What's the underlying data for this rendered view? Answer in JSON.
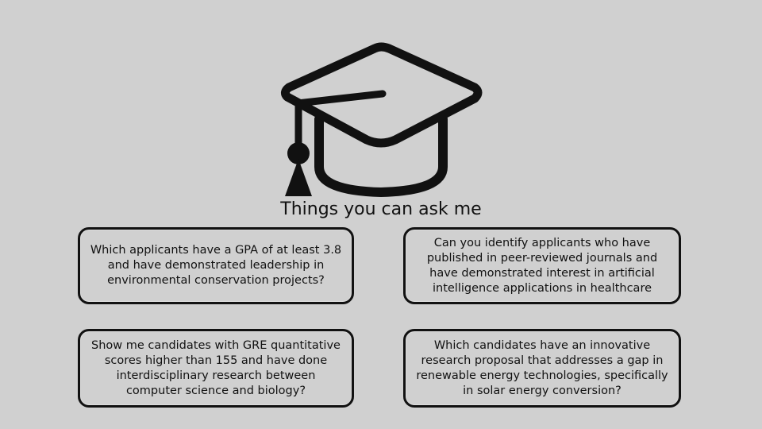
{
  "logo_icon": "graduation-cap-icon",
  "heading": "Things you can ask me",
  "suggestions": [
    {
      "text": "Which applicants have a GPA of at least 3.8 and have demonstrated leadership in environmental conservation projects?"
    },
    {
      "text": "Can you identify applicants who have published in peer-reviewed journals and have demonstrated interest in artificial intelligence applications in healthcare"
    },
    {
      "text": "Show me candidates with GRE quantitative scores higher than 155 and have done interdisciplinary research between computer science and biology?"
    },
    {
      "text": "Which candidates have an innovative research proposal that addresses a gap in renewable energy technologies, specifically in solar energy conversion?"
    }
  ]
}
